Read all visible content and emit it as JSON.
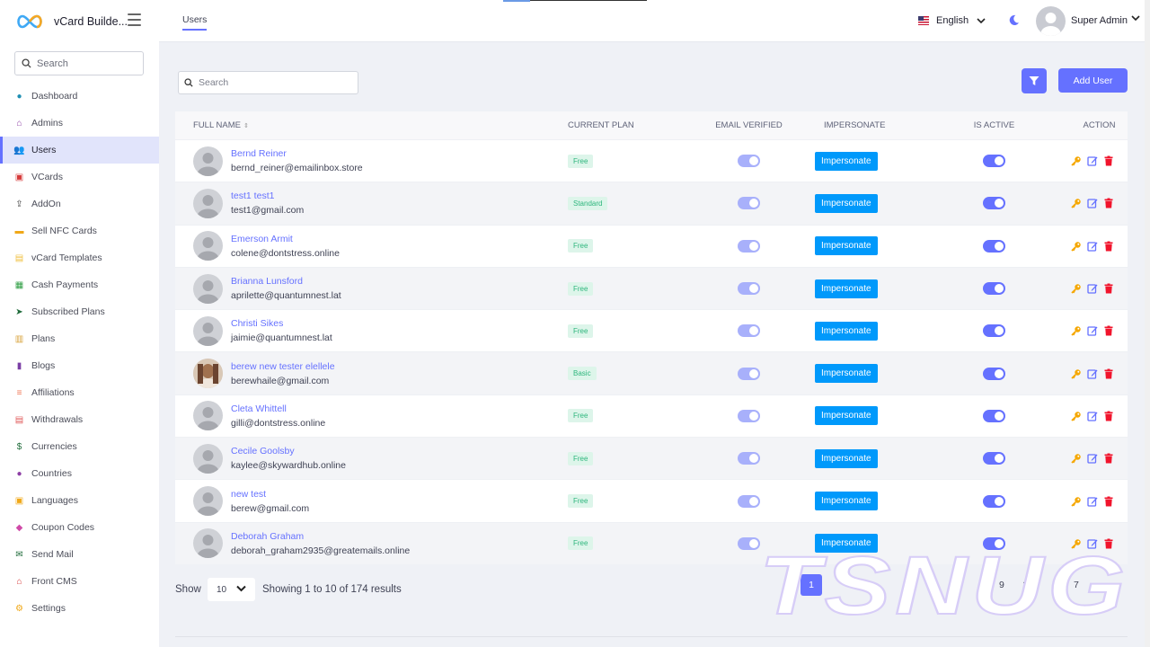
{
  "app": {
    "name": "vCard Builde..."
  },
  "sidebar": {
    "search_placeholder": "Search",
    "items": [
      {
        "label": "Dashboard",
        "icon": "dashboard-icon",
        "color": "#1f8fb3"
      },
      {
        "label": "Admins",
        "icon": "admin-icon",
        "color": "#8e3fa5"
      },
      {
        "label": "Users",
        "icon": "users-icon",
        "color": "#3aa757",
        "active": true
      },
      {
        "label": "VCards",
        "icon": "vcard-icon",
        "color": "#d63a3a"
      },
      {
        "label": "AddOn",
        "icon": "upload-icon",
        "color": "#444"
      },
      {
        "label": "Sell NFC Cards",
        "icon": "card-icon",
        "color": "#f0a818"
      },
      {
        "label": "vCard Templates",
        "icon": "template-icon",
        "color": "#f0c040"
      },
      {
        "label": "Cash Payments",
        "icon": "cash-icon",
        "color": "#2f9e44"
      },
      {
        "label": "Subscribed Plans",
        "icon": "paper-plane-icon",
        "color": "#1f6b3a"
      },
      {
        "label": "Plans",
        "icon": "columns-icon",
        "color": "#d8a23a"
      },
      {
        "label": "Blogs",
        "icon": "book-icon",
        "color": "#7b3fa5"
      },
      {
        "label": "Affiliations",
        "icon": "affiliation-icon",
        "color": "#f07a5a"
      },
      {
        "label": "Withdrawals",
        "icon": "withdraw-icon",
        "color": "#e05a5a"
      },
      {
        "label": "Currencies",
        "icon": "dollar-icon",
        "color": "#1f6b3a"
      },
      {
        "label": "Countries",
        "icon": "globe-icon",
        "color": "#8e3fa5"
      },
      {
        "label": "Languages",
        "icon": "language-icon",
        "color": "#f0a818"
      },
      {
        "label": "Coupon Codes",
        "icon": "tag-icon",
        "color": "#d04aa8"
      },
      {
        "label": "Send Mail",
        "icon": "mail-icon",
        "color": "#1f6b3a"
      },
      {
        "label": "Front CMS",
        "icon": "home-icon",
        "color": "#d63a3a"
      },
      {
        "label": "Settings",
        "icon": "gear-icon",
        "color": "#f0a818"
      }
    ]
  },
  "topbar": {
    "tab": "Users",
    "language": "English",
    "user": "Super Admin"
  },
  "main": {
    "search_placeholder": "Search",
    "add_button": "Add User",
    "columns": {
      "name": "FULL NAME",
      "plan": "CURRENT PLAN",
      "email_verified": "EMAIL VERIFIED",
      "impersonate": "IMPERSONATE",
      "active": "IS ACTIVE",
      "action": "ACTION"
    },
    "impersonate_label": "Impersonate",
    "rows": [
      {
        "name": "Bernd Reiner",
        "email": "bernd_reiner@emailinbox.store",
        "plan": "Free",
        "photo": false
      },
      {
        "name": "test1 test1",
        "email": "test1@gmail.com",
        "plan": "Standard",
        "photo": false
      },
      {
        "name": "Emerson Armit",
        "email": "colene@dontstress.online",
        "plan": "Free",
        "photo": false
      },
      {
        "name": "Brianna Lunsford",
        "email": "aprilette@quantumnest.lat",
        "plan": "Free",
        "photo": false
      },
      {
        "name": "Christi Sikes",
        "email": "jaimie@quantumnest.lat",
        "plan": "Free",
        "photo": false
      },
      {
        "name": "berew new tester elellele",
        "email": "berewhaile@gmail.com",
        "plan": "Basic",
        "photo": true
      },
      {
        "name": "Cleta Whittell",
        "email": "gilli@dontstress.online",
        "plan": "Free",
        "photo": false
      },
      {
        "name": "Cecile Goolsby",
        "email": "kaylee@skywardhub.online",
        "plan": "Free",
        "photo": false
      },
      {
        "name": "new test",
        "email": "berew@gmail.com",
        "plan": "Free",
        "photo": false
      },
      {
        "name": "Deborah Graham",
        "email": "deborah_graham2935@greatemails.online",
        "plan": "Free",
        "photo": false
      }
    ]
  },
  "footer": {
    "show_label": "Show",
    "per_page": "10",
    "results_text": "Showing 1 to 10 of 174 results",
    "pages": [
      "1",
      "9",
      "1",
      "7"
    ]
  },
  "watermark": "TSNUG",
  "colors": {
    "accent": "#6571ff",
    "impersonate": "#0099fb",
    "plan_badge": "#2eb67d",
    "delete": "#f1142c",
    "key": "#f5a700"
  }
}
